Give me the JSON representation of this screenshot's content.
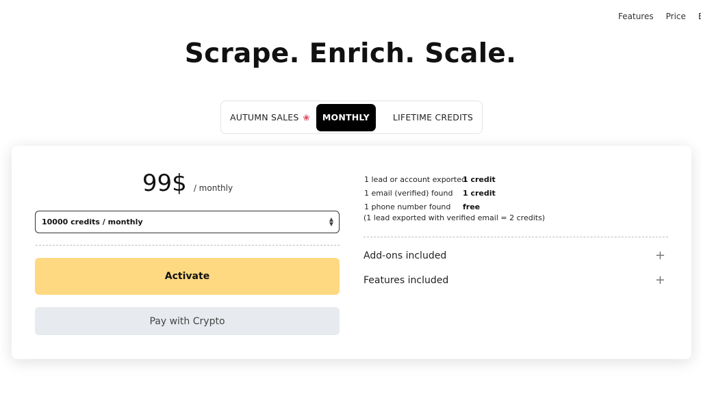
{
  "nav": {
    "items": [
      "Features",
      "Price",
      "Bl"
    ]
  },
  "headline": "Scrape. Enrich. Scale.",
  "tabs": [
    {
      "label": "AUTUMN SALES",
      "icon": "maple-leaf-icon",
      "active": false
    },
    {
      "label": "MONTHLY",
      "active": true
    },
    {
      "label": "LIFETIME CREDITS",
      "active": false
    }
  ],
  "plan": {
    "price": "99$",
    "period": "/ monthly",
    "selected_option": "10000 credits / monthly",
    "activate_label": "Activate",
    "crypto_label": "Pay with Crypto"
  },
  "credits": {
    "rows": [
      {
        "label": "1 lead or account exported",
        "value": "1 credit"
      },
      {
        "label": "1 email (verified) found",
        "value": "1 credit"
      },
      {
        "label": "1 phone number found",
        "value": "free"
      }
    ],
    "note": "(1 lead exported with verified email = 2 credits)"
  },
  "accordions": {
    "addons_label": "Add-ons included",
    "features_label": "Features included"
  },
  "colors": {
    "activate_bg": "#ffd982",
    "crypto_bg": "#e7ebef",
    "active_tab_bg": "#000000",
    "leaf": "#d9455a"
  }
}
